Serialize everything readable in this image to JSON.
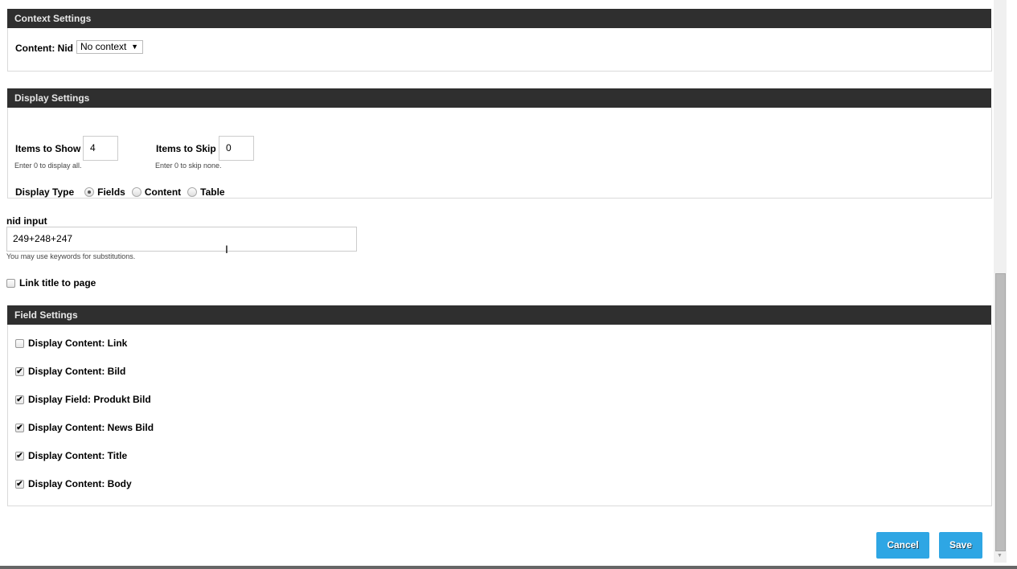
{
  "context": {
    "title": "Context Settings",
    "label": "Content: Nid",
    "select_value": "No context"
  },
  "display": {
    "title": "Display Settings",
    "items_show_label": "Items to Show",
    "items_show_value": "4",
    "items_show_help": "Enter 0 to display all.",
    "items_skip_label": "Items to Skip",
    "items_skip_value": "0",
    "items_skip_help": "Enter 0 to skip none.",
    "type_label": "Display Type",
    "types": [
      {
        "label": "Fields",
        "selected": true
      },
      {
        "label": "Content",
        "selected": false
      },
      {
        "label": "Table",
        "selected": false
      }
    ]
  },
  "nid": {
    "label": "nid input",
    "value": "249+248+247",
    "help": "You may use keywords for substitutions."
  },
  "link_title": {
    "label": "Link title to page",
    "checked": false
  },
  "fields": {
    "title": "Field Settings",
    "items": [
      {
        "label": "Display Content: Link",
        "checked": false
      },
      {
        "label": "Display Content: Bild",
        "checked": true
      },
      {
        "label": "Display Field: Produkt Bild",
        "checked": true
      },
      {
        "label": "Display Content: News Bild",
        "checked": true
      },
      {
        "label": "Display Content: Title",
        "checked": true
      },
      {
        "label": "Display Content: Body",
        "checked": true
      }
    ]
  },
  "buttons": {
    "cancel": "Cancel",
    "save": "Save"
  },
  "colors": {
    "header": "#2f2f2f",
    "button": "#2ea6e4"
  }
}
